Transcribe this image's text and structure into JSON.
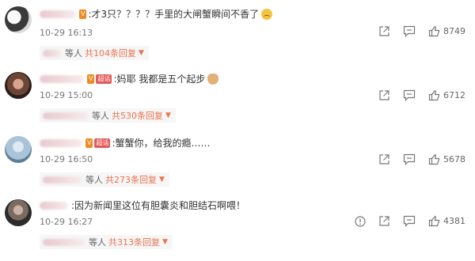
{
  "comments": [
    {
      "text": "才3只？？？？手里的大闸蟹瞬间不香了",
      "emoji": "sad-face-emoji",
      "time": "10-29 16:13",
      "replies_suffix": "等人",
      "replies_count": "共104条回复",
      "likes": "8749",
      "has_report_icon": false,
      "avatar_colors": [
        "#3a3a3a",
        "#d9d9d9"
      ]
    },
    {
      "text": "妈耶 我都是五个起步",
      "emoji": "cat-emoji",
      "badge": "超话",
      "time": "10-29 15:00",
      "replies_suffix": "等人",
      "replies_count": "共530条回复",
      "likes": "6712",
      "has_report_icon": false,
      "avatar_colors": [
        "#8a5a48",
        "#2a1e1a"
      ]
    },
    {
      "text": "蟹蟹你，给我的瘾……",
      "badge": "超话",
      "time": "10-29 16:50",
      "replies_suffix": "等人",
      "replies_count": "共273条回复",
      "likes": "5678",
      "has_report_icon": false,
      "avatar_colors": [
        "#a9c3d8",
        "#5f7f96"
      ]
    },
    {
      "text": "因为新闻里这位有胆囊炎和胆结石啊喂！",
      "time": "10-29 16:27",
      "replies_suffix": "等人",
      "replies_count": "共313条回复",
      "likes": "4381",
      "has_report_icon": true,
      "avatar_colors": [
        "#2c2a2a",
        "#7b6a5f"
      ]
    }
  ]
}
